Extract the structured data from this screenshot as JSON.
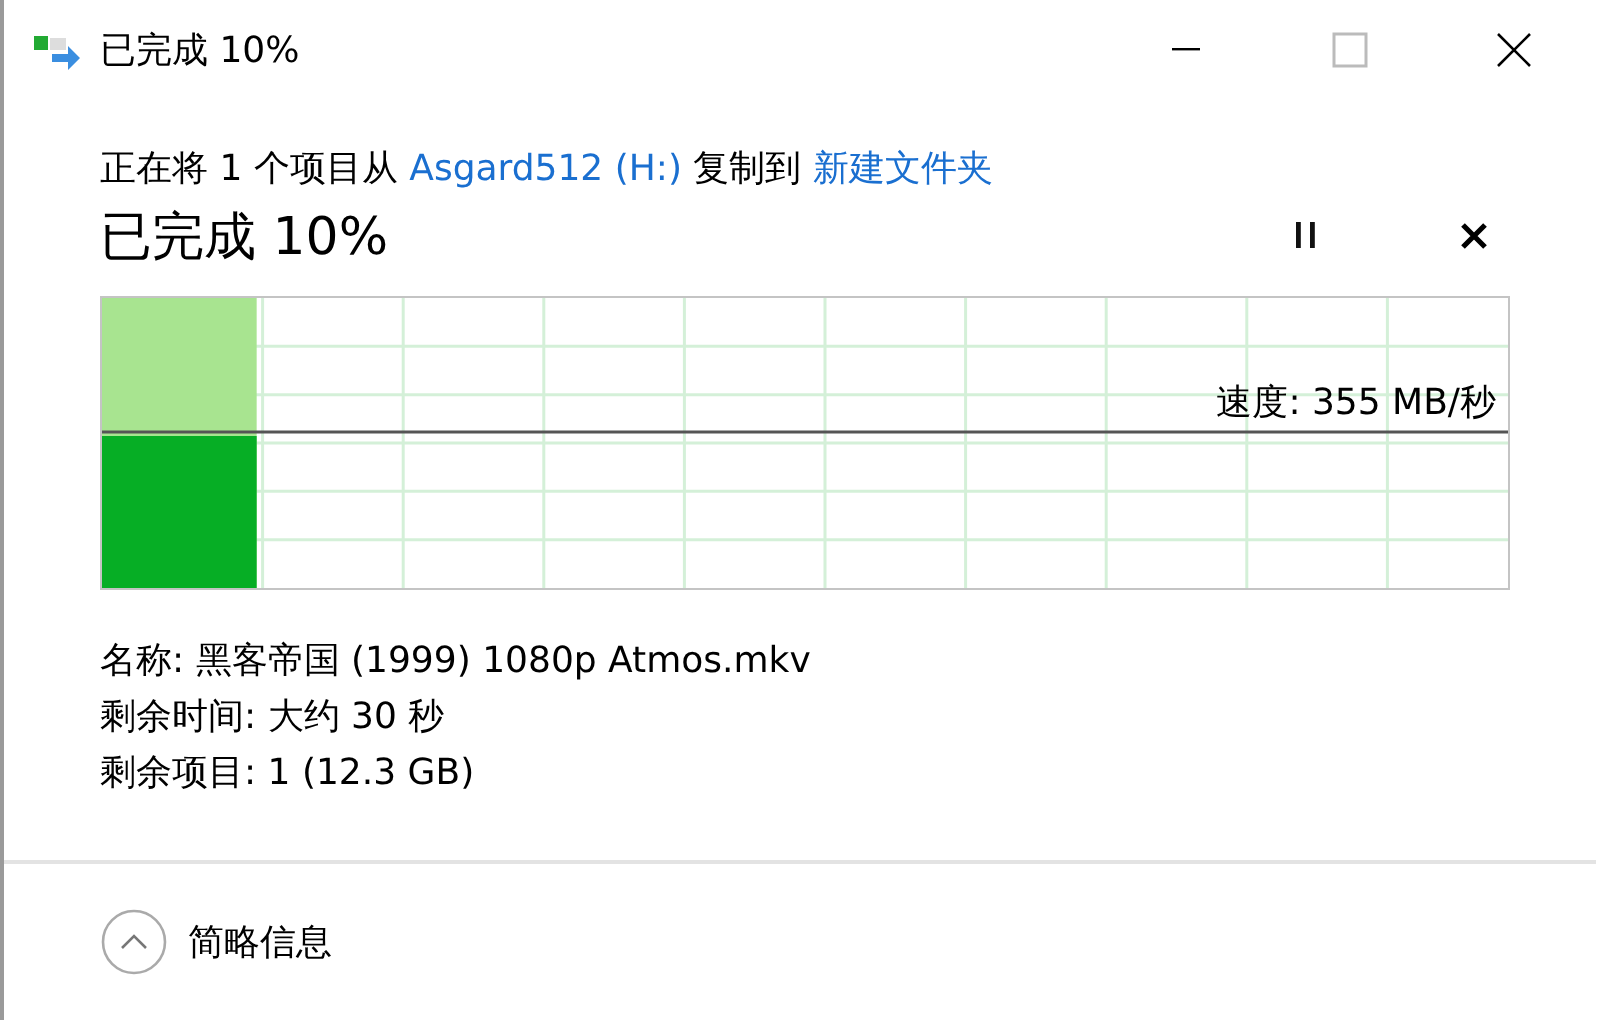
{
  "window": {
    "title": "已完成 10%"
  },
  "description": {
    "before": "正在将 1 个项目从 ",
    "source": "Asgard512 (H:)",
    "between": " 复制到 ",
    "destination": "新建文件夹"
  },
  "heading": "已完成 10%",
  "progress": {
    "level": 0.11,
    "speed": "速度: 355 MB/秒"
  },
  "details": [
    "名称: 黑客帝国 (1999) 1080p Atmos.mkv",
    "剩余时间: 大约 30 秒",
    "剩余项目: 1 (12.3 GB)"
  ],
  "footer": {
    "toggle": "简略信息",
    "expanded": true
  }
}
